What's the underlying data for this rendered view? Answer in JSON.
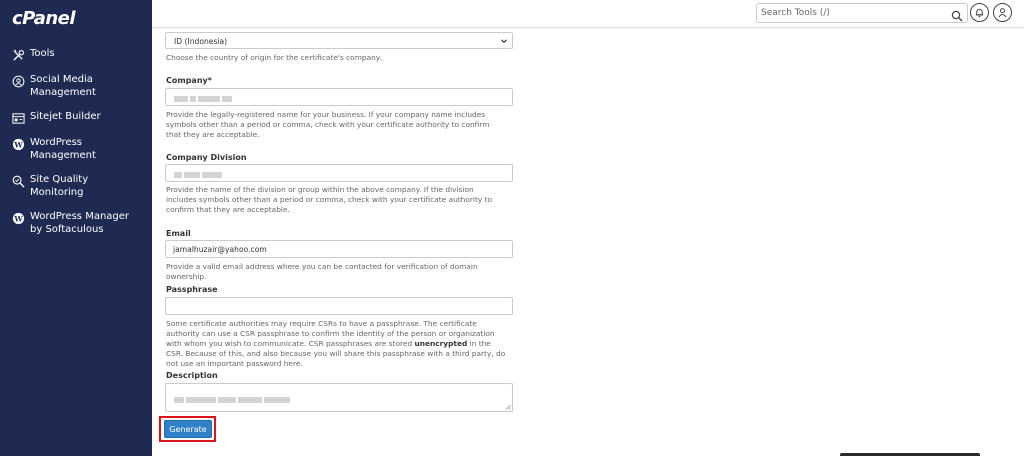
{
  "app": {
    "logo": "cPanel"
  },
  "sidebar": {
    "items": [
      {
        "label": "Tools",
        "icon": "tools-icon"
      },
      {
        "label": "Social Media Management",
        "icon": "social-media-icon"
      },
      {
        "label": "Sitejet Builder",
        "icon": "sitejet-icon"
      },
      {
        "label": "WordPress Management",
        "icon": "wordpress-icon"
      },
      {
        "label": "Site Quality Monitoring",
        "icon": "site-quality-icon"
      },
      {
        "label": "WordPress Manager by Softaculous",
        "icon": "wordpress-icon"
      }
    ]
  },
  "topbar": {
    "search_placeholder": "Search Tools (/)",
    "search_icon": "search-icon",
    "notifications_icon": "bell-icon",
    "user_icon": "user-icon"
  },
  "form": {
    "country": {
      "selected": "ID (Indonesia)",
      "help": "Choose the country of origin for the certificate's company."
    },
    "company": {
      "label": "Company*",
      "help": "Provide the legally-registered name for your business. If your company name includes symbols other than a period or comma, check with your certificate authority to confirm that they are acceptable."
    },
    "division": {
      "label": "Company Division",
      "help": "Provide the name of the division or group within the above company. If the division includes symbols other than a period or comma, check with your certificate authority to confirm that they are acceptable."
    },
    "email": {
      "label": "Email",
      "value": "jamalhuzair@yahoo.com",
      "help": "Provide a valid email address where you can be contacted for verification of domain ownership."
    },
    "passphrase": {
      "label": "Passphrase",
      "help_part1": "Some certificate authorities may require CSRs to have a passphrase. The certificate authority can use a CSR passphrase to confirm the identity of the person or organization with whom you wish to communicate. CSR passphrases are stored ",
      "help_bold": "unencrypted",
      "help_part2": " in the CSR. Because of this, and also because you will share this passphrase with a third party, do not use an important password here."
    },
    "description": {
      "label": "Description"
    },
    "generate_label": "Generate"
  }
}
